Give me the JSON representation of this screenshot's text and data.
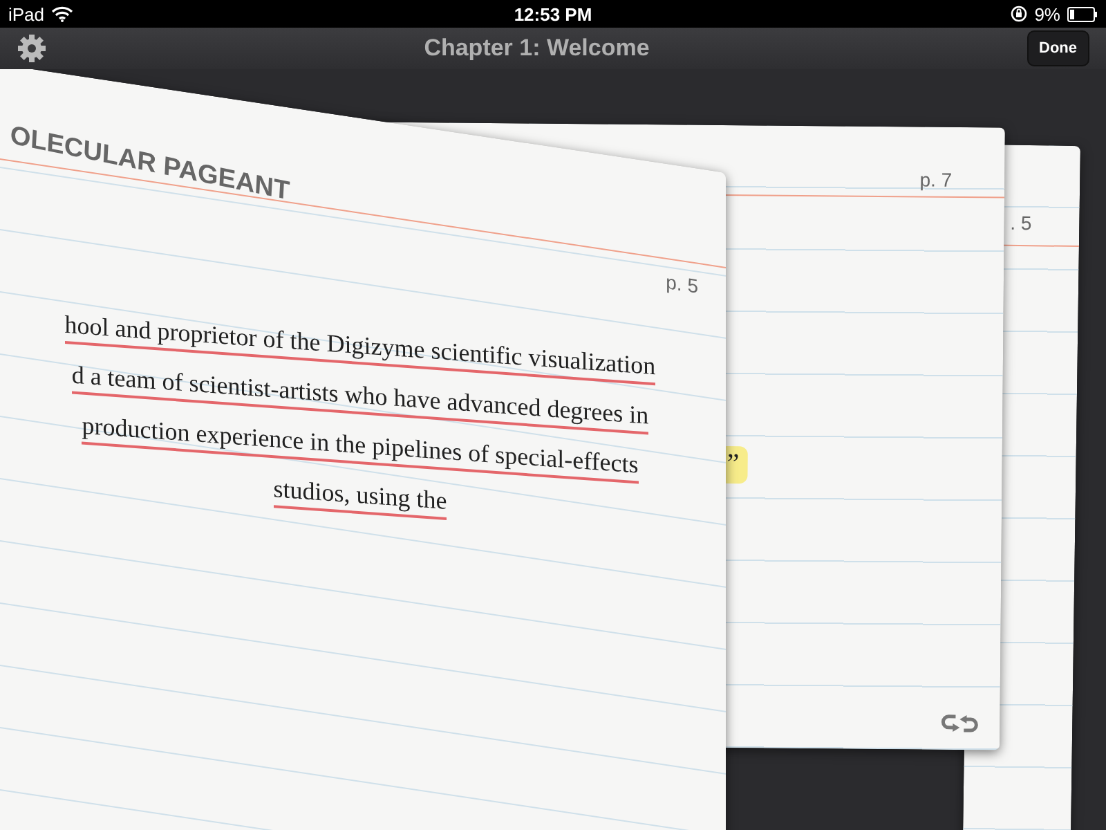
{
  "status_bar": {
    "carrier": "iPad",
    "time": "12:53 PM",
    "battery": "9%"
  },
  "nav_bar": {
    "title": "Chapter 1: Welcome",
    "done_button": "Done"
  },
  "back_card": {
    "page": ". 5"
  },
  "middle_card": {
    "page": "p. 7",
    "highlight": "”"
  },
  "front_card": {
    "heading": "OLECULAR PAGEANT",
    "page": "p. 5",
    "lines": [
      "hool and proprietor of the Digizyme scientific visualization",
      "d a team of scientist-artists who have advanced degrees in",
      "production experience in the pipelines of special-effects",
      "studios, using the"
    ]
  }
}
